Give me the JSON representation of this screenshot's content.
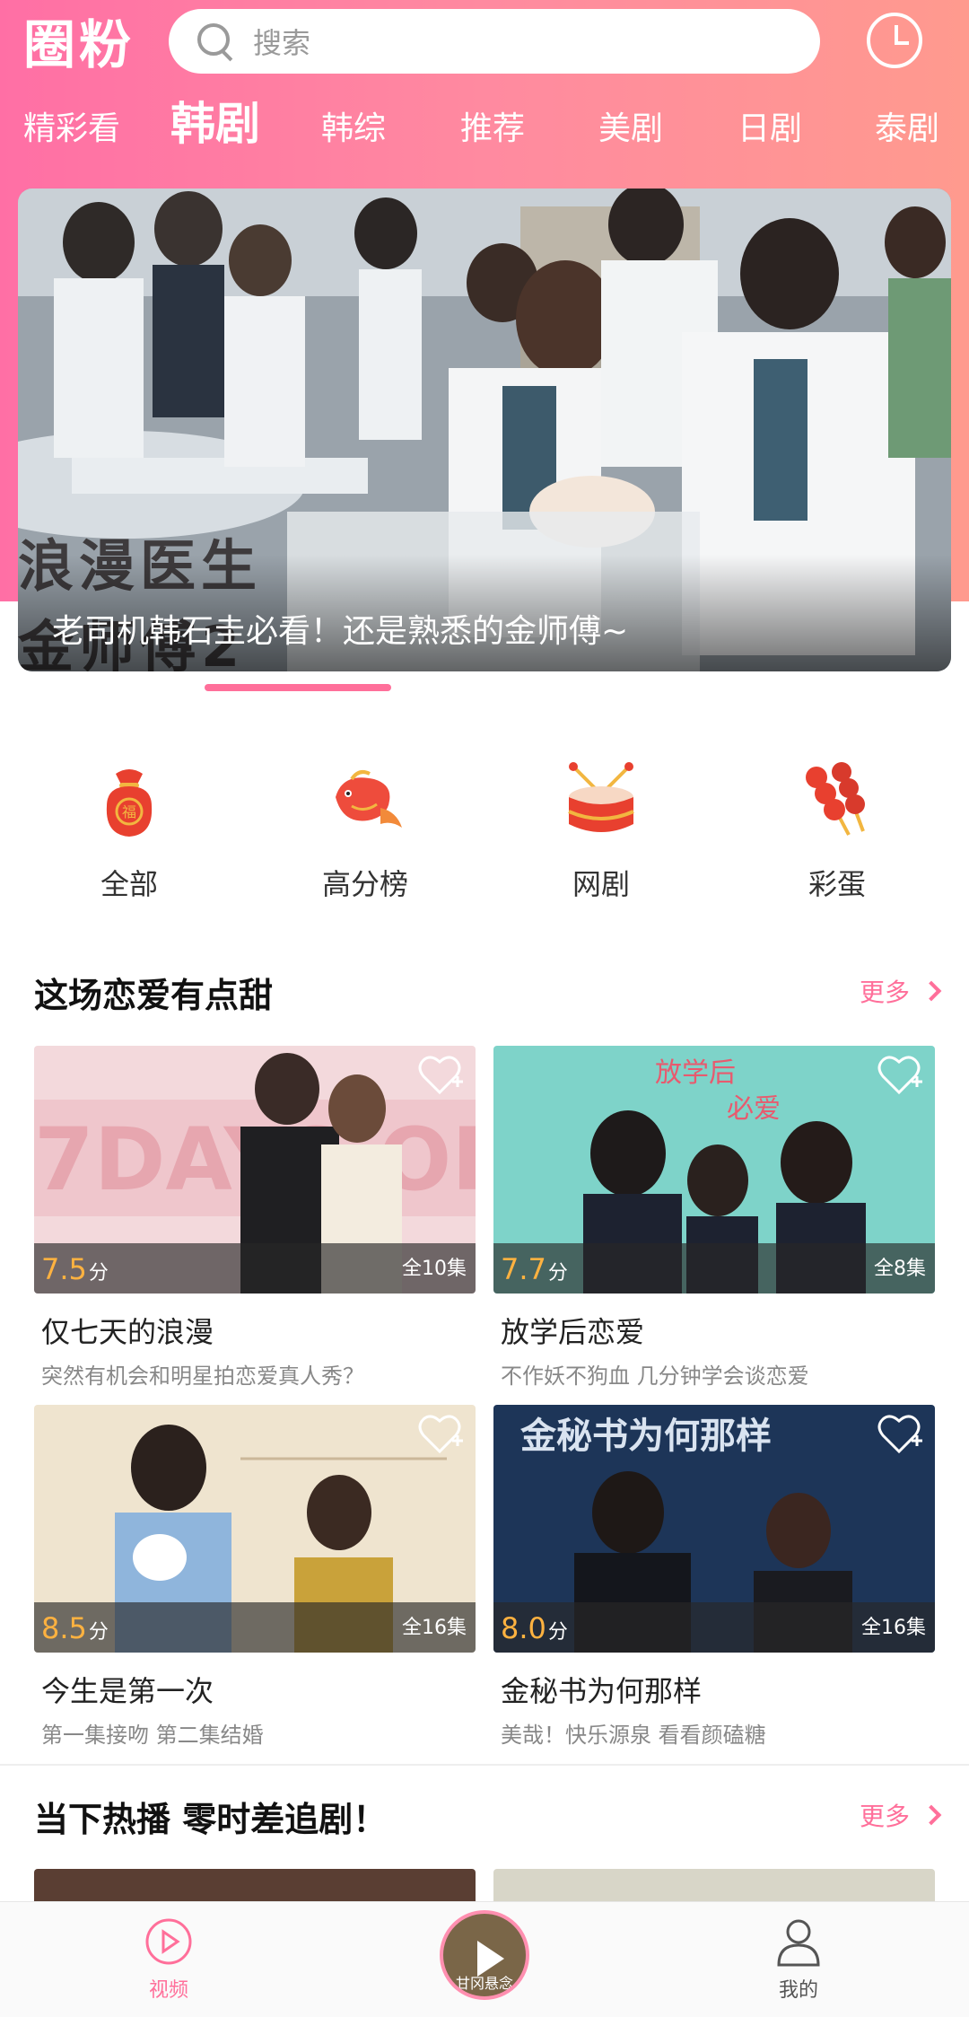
{
  "header": {
    "logo": "圈粉",
    "search_placeholder": "搜索"
  },
  "tabs": [
    {
      "label": "精彩看",
      "active": false
    },
    {
      "label": "韩剧",
      "active": true
    },
    {
      "label": "韩综",
      "active": false
    },
    {
      "label": "推荐",
      "active": false
    },
    {
      "label": "美剧",
      "active": false
    },
    {
      "label": "日剧",
      "active": false
    },
    {
      "label": "泰剧",
      "active": false
    }
  ],
  "banner": {
    "art_title": "浪漫医生\n金师傅2",
    "caption": "老司机韩石圭必看！还是熟悉的金师傅~"
  },
  "categories": [
    {
      "label": "全部",
      "icon": "lucky-bag-icon"
    },
    {
      "label": "高分榜",
      "icon": "koi-fish-icon"
    },
    {
      "label": "网剧",
      "icon": "drum-icon"
    },
    {
      "label": "彩蛋",
      "icon": "candied-haws-icon"
    }
  ],
  "sections": [
    {
      "title": "这场恋爱有点甜",
      "more": "更多",
      "cards": [
        {
          "title": "仅七天的浪漫",
          "subtitle": "突然有机会和明星拍恋爱真人秀？",
          "score": "7.5",
          "score_unit": "分",
          "episodes": "全10集"
        },
        {
          "title": "放学后恋爱",
          "subtitle": "不作妖不狗血 几分钟学会谈恋爱",
          "score": "7.7",
          "score_unit": "分",
          "episodes": "全8集"
        },
        {
          "title": "今生是第一次",
          "subtitle": "第一集接吻 第二集结婚",
          "score": "8.5",
          "score_unit": "分",
          "episodes": "全16集"
        },
        {
          "title": "金秘书为何那样",
          "subtitle": "美哉！快乐源泉 看看颜磕糖",
          "score": "8.0",
          "score_unit": "分",
          "episodes": "全16集"
        }
      ]
    },
    {
      "title": "当下热播 零时差追剧！",
      "more": "更多"
    }
  ],
  "bottom_nav": {
    "video": "视频",
    "center_caption": "甘冈悬念",
    "mine": "我的"
  },
  "colors": {
    "brand_pink": "#ff6f9a",
    "score_orange": "#ffb240"
  }
}
